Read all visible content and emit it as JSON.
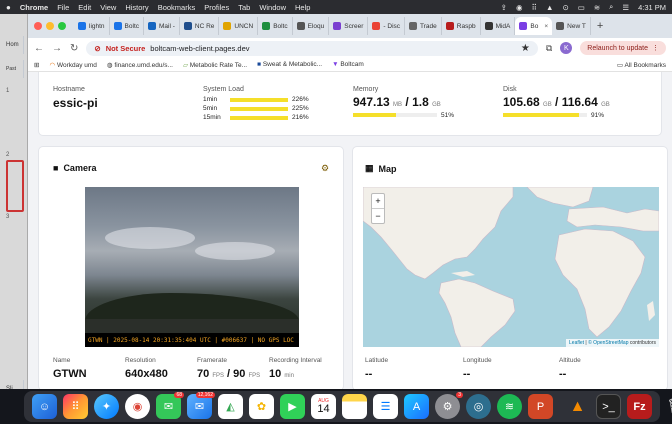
{
  "menubar": {
    "app": "Chrome",
    "items": [
      "File",
      "Edit",
      "View",
      "History",
      "Bookmarks",
      "Profiles",
      "Tab",
      "Window",
      "Help"
    ],
    "time": "4:31 PM"
  },
  "background_app": {
    "label": "Hom",
    "sub": "Past",
    "numbers": [
      "1",
      "2",
      "3"
    ],
    "bottom": "Sli"
  },
  "tabs": [
    {
      "label": "lightn",
      "color": "#1a73e8"
    },
    {
      "label": "Boltc",
      "color": "#1a73e8"
    },
    {
      "label": "Mail -",
      "color": "#1565c0"
    },
    {
      "label": "NC Re",
      "color": "#1f4e8c"
    },
    {
      "label": "UNCN",
      "color": "#e0a400"
    },
    {
      "label": "Boltc",
      "color": "#1e8e3e"
    },
    {
      "label": "Eloqu",
      "color": "#555555"
    },
    {
      "label": "Screer",
      "color": "#7a3fd0"
    },
    {
      "label": "- Disc",
      "color": "#ea4335"
    },
    {
      "label": "Trade",
      "color": "#666666"
    },
    {
      "label": "Raspb",
      "color": "#b71c1c"
    },
    {
      "label": "MidA",
      "color": "#333333"
    },
    {
      "label": "Bo",
      "color": "#7b3fe4",
      "active": true
    },
    {
      "label": "New T",
      "color": "#555555"
    }
  ],
  "toolbar": {
    "not_secure": "Not Secure",
    "url": "boltcam-web-client.pages.dev",
    "profile_initial": "K",
    "relaunch": "Relaunch to update"
  },
  "bookmarks": [
    "Workday umd",
    "finance.umd.edu/s...",
    "Metabolic Rate Te...",
    "Sweat & Metabolic...",
    "Boltcam"
  ],
  "all_bookmarks": "All Bookmarks",
  "stats": {
    "hostname_label": "Hostname",
    "hostname": "essic-pi",
    "sysload_label": "System Load",
    "loads": [
      {
        "name": "1min",
        "pct": "226%",
        "fill": 1.0
      },
      {
        "name": "5min",
        "pct": "225%",
        "fill": 1.0
      },
      {
        "name": "15min",
        "pct": "216%",
        "fill": 1.0
      }
    ],
    "memory_label": "Memory",
    "memory_used": "947.13",
    "memory_used_unit": "MB",
    "memory_total": "1.8",
    "memory_total_unit": "GB",
    "memory_pct": "51%",
    "memory_fill": 0.51,
    "disk_label": "Disk",
    "disk_used": "105.68",
    "disk_used_unit": "GB",
    "disk_total": "116.64",
    "disk_total_unit": "GB",
    "disk_pct": "91%",
    "disk_fill": 0.91
  },
  "camera": {
    "title": "Camera",
    "overlay": "GTWN | 2025-08-14 20:31:35:404 UTC | #006637 | NO GPS LOC",
    "name_label": "Name",
    "name": "GTWN",
    "resolution_label": "Resolution",
    "resolution": "640x480",
    "framerate_label": "Framerate",
    "framerate_a": "70",
    "framerate_b": "90",
    "fps_unit": "FPS",
    "rec_label": "Recording Interval",
    "rec_value": "10",
    "rec_unit": "min"
  },
  "map": {
    "title": "Map",
    "zoom_in": "+",
    "zoom_out": "−",
    "attr_leaflet": "Leaflet",
    "attr_osm": "© OpenStreetMap",
    "attr_contrib": "contributors",
    "lat_label": "Latitude",
    "lat": "--",
    "lon_label": "Longitude",
    "lon": "--",
    "alt_label": "Altitude",
    "alt": "--"
  },
  "dock": {
    "calendar_month": "AUG",
    "calendar_day": "14",
    "mail_badge": "12,162",
    "messages_badge": "68",
    "settings_badge": "3"
  }
}
